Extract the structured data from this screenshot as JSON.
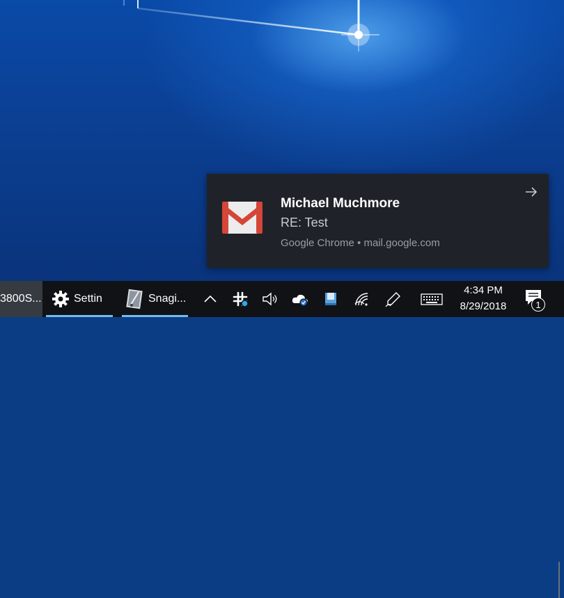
{
  "notification": {
    "sender": "Michael Muchmore",
    "subject": "RE: Test",
    "source": "Google Chrome • mail.google.com",
    "app_icon": "gmail-icon",
    "accent_color": "#d44638"
  },
  "taskbar": {
    "items": [
      {
        "label": "3800S...",
        "icon": "none",
        "active": true
      },
      {
        "label": "Settin",
        "icon": "gear-icon",
        "active": false
      },
      {
        "label": "Snagi...",
        "icon": "snagit-icon",
        "active": false
      }
    ],
    "tray_icons": [
      "chevron-up-icon",
      "slack-icon",
      "volume-icon",
      "onedrive-icon",
      "app-tray-icon",
      "wifi-icon",
      "pen-icon",
      "keyboard-icon"
    ],
    "time": "4:34 PM",
    "date": "8/29/2018",
    "notification_count": "1",
    "underline_color": "#76b9ed"
  }
}
